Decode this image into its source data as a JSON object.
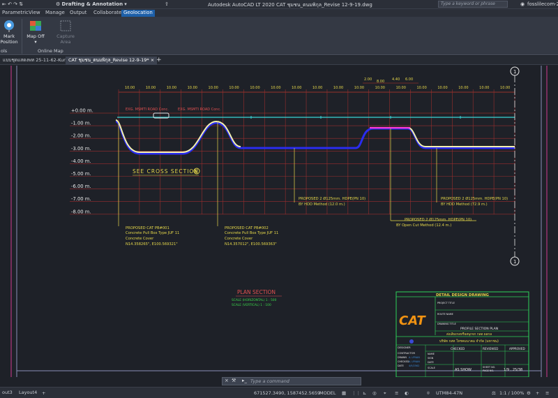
{
  "titlebar": {
    "workspace": "Drafting & Annotation",
    "title": "Autodesk AutoCAD LT 2020    CAT ชุมชน_ตนมพิกุล_Revise 12-9-19.dwg",
    "search_placeholder": "Type a keyword or phrase",
    "user": "fosslilecom-20"
  },
  "ribbon_tabs": [
    "Parametric",
    "View",
    "Manage",
    "Output",
    "Collaborate",
    "Geolocation"
  ],
  "active_tab": "Geolocation",
  "ribbon": {
    "mark_position": "Mark\nPosition",
    "map_off": "Map Off",
    "capture_area": "Capture\nArea",
    "tools_panel": "ols",
    "online_map_panel": "Online Map"
  },
  "doc_tabs": [
    {
      "label": "แบบชุดแสดงพท 25-11-62-Kung*",
      "active": false
    },
    {
      "label": "CAT ชุมชน_ตนมพิกุล_Revise 12-9-19*",
      "active": true
    }
  ],
  "drawing": {
    "elevations": [
      "+0.00 m.",
      "-1.00 m.",
      "-2.00 m.",
      "-3.00 m.",
      "-4.00 m.",
      "-5.00 m.",
      "-6.00 m.",
      "-7.00 m.",
      "-8.00 m."
    ],
    "top_dims": [
      "10.00",
      "10.00",
      "10.00",
      "10.00",
      "10.00",
      "10.00",
      "10.00",
      "10.00",
      "10.00",
      "10.00",
      "10.00",
      "10.00",
      "10.00",
      "10.00",
      "10.00",
      "10.00",
      "10.00",
      "10.00",
      "10.00"
    ],
    "small_dims": [
      "2.00",
      "8.00",
      "4.40",
      "6.00"
    ],
    "road1": "EXG. MSMTI\nROAD Conc.",
    "road2": "EXG. MSMTI\nROAD Conc.",
    "see_cross": "SEE CROSS SECTION",
    "see_cross_ref": "B",
    "grid_bubble_top": "1",
    "grid_bubble_bottom": "1",
    "note1": [
      "PROPOSED CAT PB#001",
      "Concrete Pull Box Type JUF 11",
      "Concrete Cover",
      "N14.358265\", E100.569321\""
    ],
    "note2": [
      "PROPOSED CAT PB#002",
      "Concrete Pull Box Type JUF 11",
      "Concrete Cover",
      "N14.357012\", E100.569363\""
    ],
    "note3": [
      "PROPOSED 2 Ø125mm. HDPE(PN 10)",
      "BY HDD Method (12.0 m.)"
    ],
    "note4": [
      "PROPOSED 2 Ø125mm. HDPE(PN 10)",
      "BY HDD Method (72.9 m.)"
    ],
    "note5": [
      "PROPOSED 2 Ø125mm. HDPE(PN 10)",
      "BY Open Cut Method (12.4 m.)"
    ],
    "plan_title": "PLAN  SECTION",
    "scale_h": "SCALE (HORIZONTAL)   1 : 500",
    "scale_v": "SCALE (VERTICAL)       1 : 100"
  },
  "titleblock": {
    "header": "DETAIL DESIGN DRAWING",
    "logo": "CAT",
    "project_title_label": "PROJECT TITLE",
    "route_name_label": "ROUTE NAME",
    "drawing_title_label": "DRAWING TITLE",
    "drawing_title": "PROFILE SECTION PLAN",
    "thai_line": "ส่งเสียงกลหรือสนุกจก กลด ผลกล",
    "company": "บริษัท กสท โทรคมนาคม จำกัด (มหาชน)",
    "designer_label": "DESIGNER",
    "contractor_label": "CONTRACTOR",
    "drawn_label": "DRAWN",
    "checked_label": "CHECKED",
    "date_label": "DATE",
    "checked_col": "CHECKED",
    "reviewed_col": "REVIEWED",
    "approved_col": "APPROVED",
    "name_label": "NAME",
    "sign_label": "SIGN",
    "date_label2": "DATE",
    "scale_label": "SCALE",
    "scale_value": "AS SHOW",
    "sheet_label": "SHEET NO.",
    "page_label": "PAGE NO.",
    "sheet_value": "1/9 , 25/38",
    "drawn_name": "A. LPNAN",
    "checked_name": "A. LPNAN",
    "date_value": "4/9/2562"
  },
  "cmdline": {
    "placeholder": "Type a command"
  },
  "statusbar": {
    "layouts": [
      "out3",
      "Layout4"
    ],
    "coords": "671527.3490, 1587452.5659",
    "space": "MODEL",
    "crs": "UTM84-47N",
    "scale": "1:1 / 100%"
  },
  "colors": {
    "accent": "#1d5fa8",
    "grid": "#c0392b",
    "ground": "#3ad6d6",
    "pipe": "#2a2cf0",
    "yellow": "#e6d84a",
    "titleblock": "#2fd35a",
    "catlogo": "#f29312"
  }
}
